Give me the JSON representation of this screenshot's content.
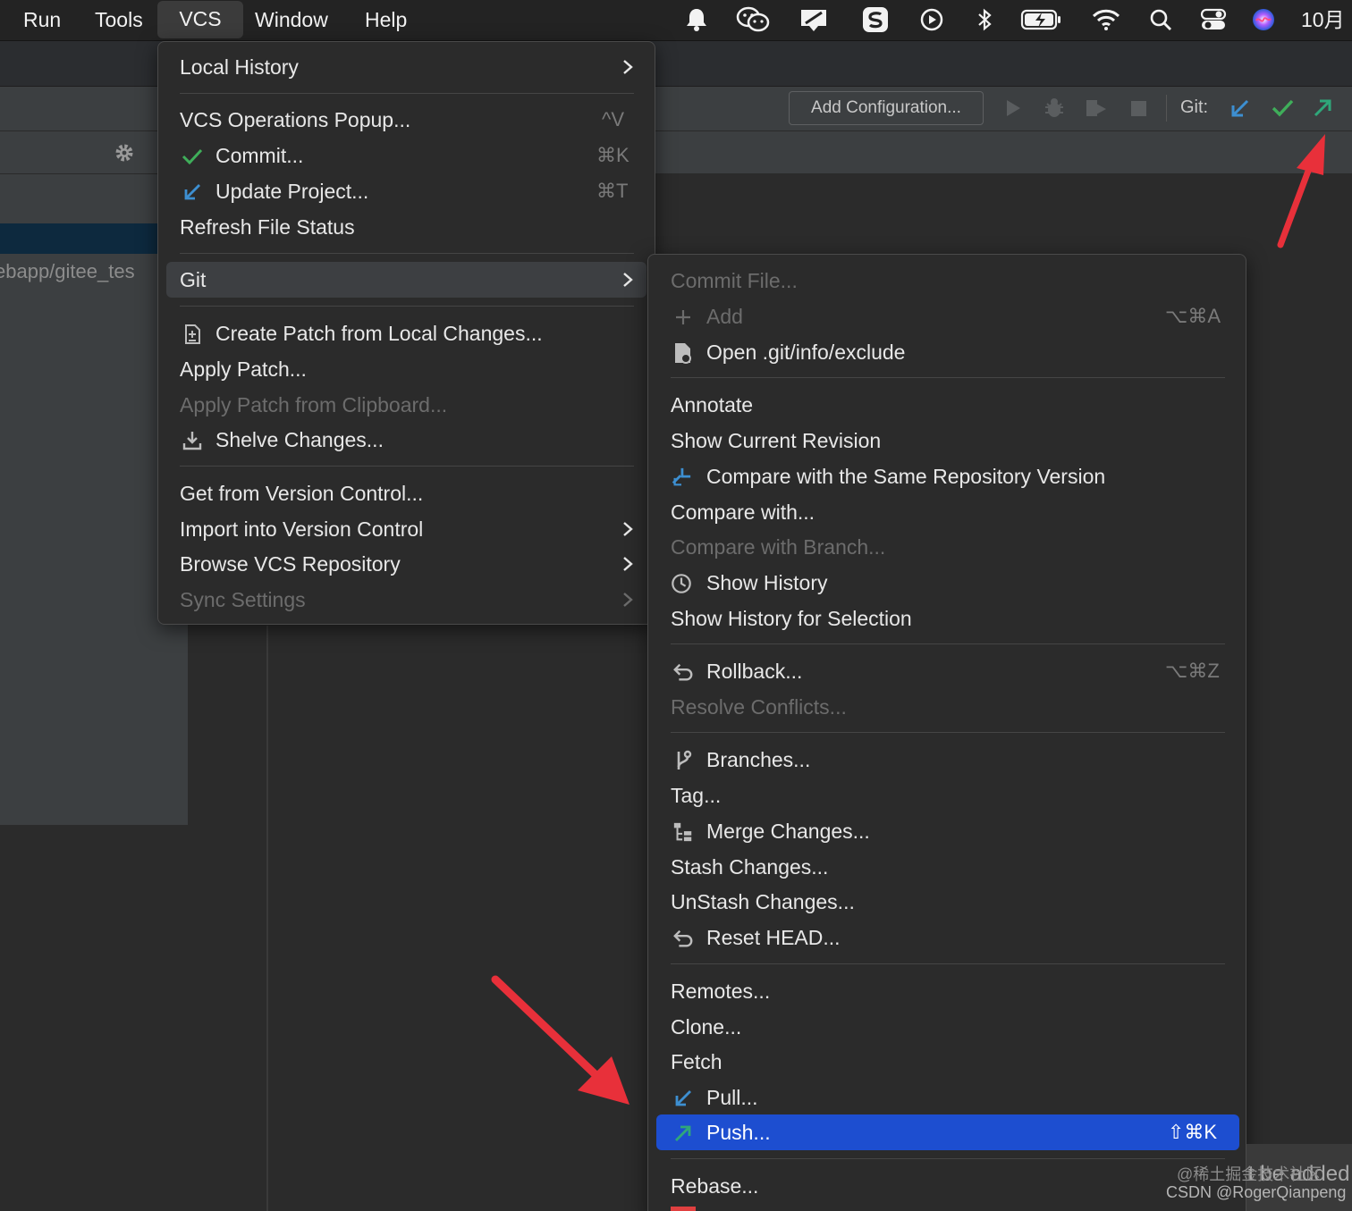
{
  "menubar": {
    "items": [
      "Run",
      "Tools",
      "VCS",
      "Window",
      "Help"
    ],
    "active": "VCS",
    "clock": "10月",
    "tray_icons": [
      "bell-icon",
      "wechat-icon",
      "display-icon",
      "s-app-icon",
      "play-icon",
      "bluetooth-icon",
      "battery-icon",
      "wifi-icon",
      "search-icon",
      "control-center-icon",
      "siri-icon"
    ]
  },
  "toolbar": {
    "add_configuration": "Add Configuration...",
    "git_label": "Git:",
    "colors": {
      "update": "#3d8fd1",
      "commit": "#3fae5a",
      "push": "#2fa77a"
    }
  },
  "project": {
    "path_fragment": "ebapp/gitee_tes"
  },
  "vcs_menu": {
    "local_history": "Local History",
    "vcs_operations_popup": "VCS Operations Popup...",
    "vcs_operations_shortcut": "^V",
    "commit": "Commit...",
    "commit_shortcut": "⌘K",
    "update_project": "Update Project...",
    "update_project_shortcut": "⌘T",
    "refresh_file_status": "Refresh File Status",
    "git": "Git",
    "create_patch": "Create Patch from Local Changes...",
    "apply_patch": "Apply Patch...",
    "apply_patch_clipboard": "Apply Patch from Clipboard...",
    "shelve_changes": "Shelve Changes...",
    "get_from_vcs": "Get from Version Control...",
    "import_into_vcs": "Import into Version Control",
    "browse_vcs_repo": "Browse VCS Repository",
    "sync_settings": "Sync Settings"
  },
  "git_menu": {
    "commit_file": "Commit File...",
    "add": "Add",
    "add_shortcut": "⌥⌘A",
    "open_exclude": "Open .git/info/exclude",
    "annotate": "Annotate",
    "show_current_revision": "Show Current Revision",
    "compare_same_repo": "Compare with the Same Repository Version",
    "compare_with": "Compare with...",
    "compare_with_branch": "Compare with Branch...",
    "show_history": "Show History",
    "show_history_selection": "Show History for Selection",
    "rollback": "Rollback...",
    "rollback_shortcut": "⌥⌘Z",
    "resolve_conflicts": "Resolve Conflicts...",
    "branches": "Branches...",
    "tag": "Tag...",
    "merge_changes": "Merge Changes...",
    "stash_changes": "Stash Changes...",
    "unstash_changes": "UnStash Changes...",
    "reset_head": "Reset HEAD...",
    "remotes": "Remotes...",
    "clone": "Clone...",
    "fetch": "Fetch",
    "pull": "Pull...",
    "push": "Push...",
    "push_shortcut": "⇧⌘K",
    "rebase": "Rebase..."
  },
  "overlay": {
    "watermark_line1": "@稀土掘金技术社区",
    "watermark_line2": "CSDN @RogerQianpeng",
    "background_text": "t be added",
    "annotation_color": "#e8303a"
  }
}
